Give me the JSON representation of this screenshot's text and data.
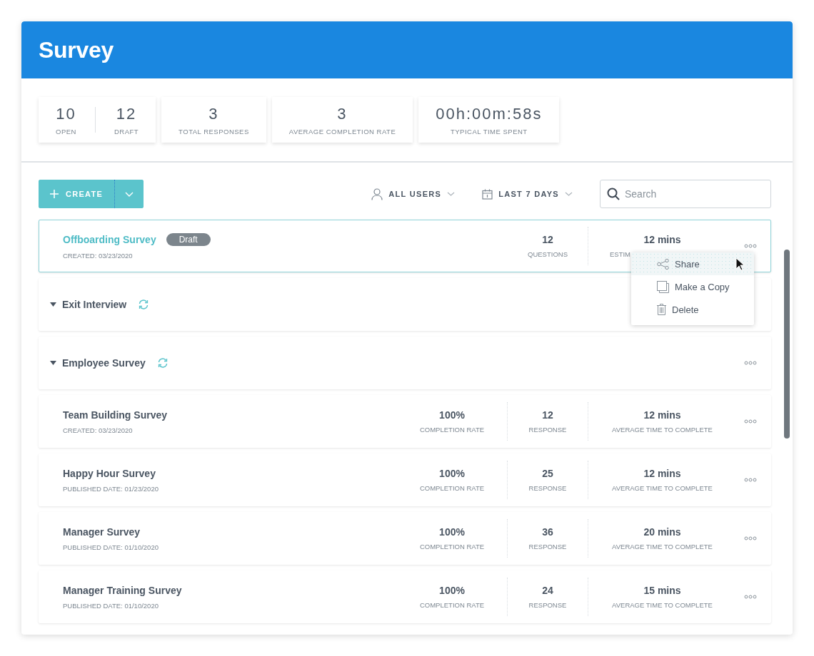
{
  "header": {
    "title": "Survey"
  },
  "stats": [
    {
      "items": [
        {
          "value": "10",
          "label": "OPEN"
        },
        {
          "value": "12",
          "label": "DRAFT"
        }
      ]
    },
    {
      "items": [
        {
          "value": "3",
          "label": "TOTAL RESPONSES"
        }
      ]
    },
    {
      "items": [
        {
          "value": "3",
          "label": "AVERAGE COMPLETION RATE"
        }
      ]
    },
    {
      "items": [
        {
          "value": "00h:00m:58s",
          "label": "TYPICAL TIME SPENT"
        }
      ]
    }
  ],
  "toolbar": {
    "create": "CREATE",
    "filters": [
      {
        "kind": "user",
        "label": "ALL USERS"
      },
      {
        "kind": "date",
        "label": "LAST 7 DAYS"
      }
    ],
    "search": {
      "placeholder": "Search"
    }
  },
  "rows": [
    {
      "kind": "draft",
      "selected": true,
      "title": "Offboarding Survey",
      "badge": "Draft",
      "date": "CREATED: 03/23/2020",
      "questions": {
        "value": "12",
        "label": "QUESTIONS"
      },
      "estimate": {
        "value": "12 mins",
        "label": "ESTIM"
      },
      "more_button": true
    },
    {
      "kind": "group",
      "selected": false,
      "title": "Exit Interview",
      "more_button": false
    },
    {
      "kind": "group",
      "selected": false,
      "title": "Employee Survey",
      "more_button": true
    },
    {
      "kind": "survey",
      "selected": false,
      "title": "Team Building Survey",
      "date": "CREATED: 03/23/2020",
      "completion": {
        "value": "100%",
        "label": "COMPLETION RATE"
      },
      "responses": {
        "value": "12",
        "label": "RESPONSE"
      },
      "time": {
        "value": "12 mins",
        "label": "AVERAGE TIME TO COMPLETE"
      },
      "more_button": true
    },
    {
      "kind": "survey",
      "selected": false,
      "title": "Happy Hour Survey",
      "date": "PUBLISHED DATE: 01/23/2020",
      "completion": {
        "value": "100%",
        "label": "COMPLETION RATE"
      },
      "responses": {
        "value": "25",
        "label": "RESPONSE"
      },
      "time": {
        "value": "12 mins",
        "label": "AVERAGE TIME TO COMPLETE"
      },
      "more_button": true
    },
    {
      "kind": "survey",
      "selected": false,
      "title": "Manager Survey",
      "date": "PUBLISHED DATE: 01/10/2020",
      "completion": {
        "value": "100%",
        "label": "COMPLETION RATE"
      },
      "responses": {
        "value": "36",
        "label": "RESPONSE"
      },
      "time": {
        "value": "20 mins",
        "label": "AVERAGE TIME TO COMPLETE"
      },
      "more_button": true
    },
    {
      "kind": "survey",
      "selected": false,
      "title": "Manager Training Survey",
      "date": "PUBLISHED DATE: 01/10/2020",
      "completion": {
        "value": "100%",
        "label": "COMPLETION RATE"
      },
      "responses": {
        "value": "24",
        "label": "RESPONSE"
      },
      "time": {
        "value": "15 mins",
        "label": "AVERAGE TIME TO COMPLETE"
      },
      "more_button": true
    }
  ],
  "menu": {
    "items": [
      {
        "kind": "share",
        "label": "Share",
        "selected": true
      },
      {
        "kind": "copy",
        "label": "Make a Copy",
        "selected": false
      },
      {
        "kind": "delete",
        "label": "Delete",
        "selected": false
      }
    ]
  }
}
